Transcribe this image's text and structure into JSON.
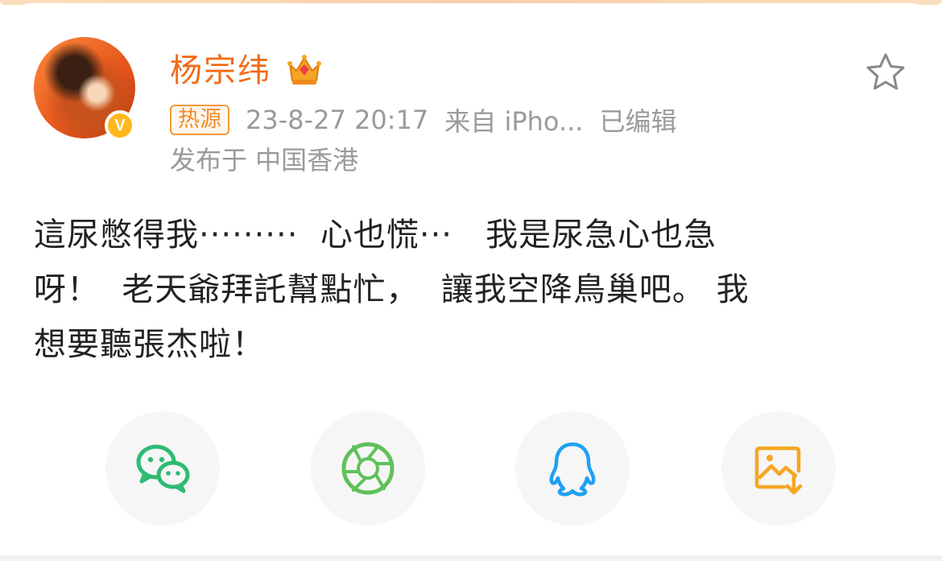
{
  "post": {
    "author": "杨宗纬",
    "verified_badge": "V",
    "hot_tag": "热源",
    "timestamp": "23-8-27 20:17",
    "source": "来自 iPho...",
    "edited": "已编辑",
    "location": "发布于 中国香港",
    "text": "這尿憋得我·········  心也慌···   我是尿急心也急\n呀！  老天爺拜託幫點忙，  讓我空降鳥巢吧。 我\n想要聽張杰啦！"
  },
  "share": [
    {
      "icon": "wechat-icon",
      "color": "#2dbb73"
    },
    {
      "icon": "moments-icon",
      "color": "#5fc15a"
    },
    {
      "icon": "qq-icon",
      "color": "#1ea0f2"
    },
    {
      "icon": "save-image-icon",
      "color": "#f5a623"
    }
  ],
  "colors": {
    "accent": "#f26b16",
    "meta_text": "#9a9a9a",
    "body_text": "#222222"
  }
}
